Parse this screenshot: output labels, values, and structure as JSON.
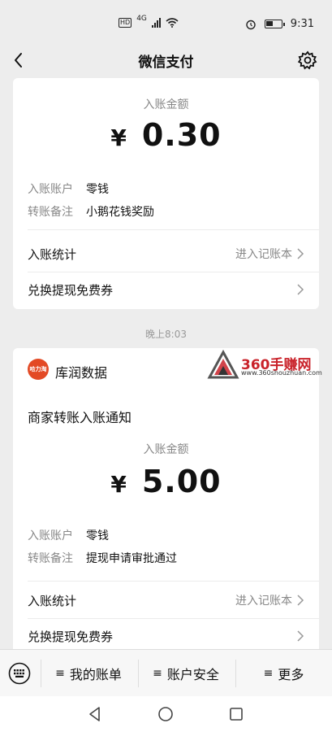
{
  "status_bar": {
    "hd": "HD",
    "network": "4G",
    "time": "9:31",
    "icons": [
      "hd-icon",
      "signal-icon",
      "wifi-icon",
      "alarm-icon",
      "battery-icon"
    ]
  },
  "nav": {
    "title": "微信支付",
    "back_icon": "back-arrow-icon",
    "settings_icon": "gear-icon"
  },
  "card1": {
    "amount_label": "入账金额",
    "currency": "¥",
    "amount": "0.30",
    "account_key": "入账账户",
    "account_val": "零钱",
    "note_key": "转账备注",
    "note_val": "小鹅花钱奖励",
    "stats_label": "入账统计",
    "stats_hint": "进入记账本",
    "coupon_label": "兑换提现免费券"
  },
  "timestamp": "晚上8:03",
  "card2": {
    "merchant_logo_text": "哈力淘",
    "merchant_name": "库润数据",
    "watermark_title": "360手赚网",
    "watermark_url": "www.360shouzhuan.com",
    "notice_title": "商家转账入账通知",
    "amount_label": "入账金额",
    "currency": "¥",
    "amount": "5.00",
    "account_key": "入账账户",
    "account_val": "零钱",
    "note_key": "转账备注",
    "note_val": "提现申请审批通过",
    "stats_label": "入账统计",
    "stats_hint": "进入记账本",
    "coupon_label": "兑换提现免费券"
  },
  "bottom_menu": {
    "keyboard_icon": "keyboard-icon",
    "items": [
      {
        "label": "我的账单"
      },
      {
        "label": "账户安全"
      },
      {
        "label": "更多"
      }
    ],
    "menu_glyph": "≡"
  },
  "colors": {
    "background": "#ededed",
    "card": "#ffffff",
    "text": "#111111",
    "muted": "#888888",
    "watermark_red": "#c9222a",
    "merchant_logo": "#e34a25"
  }
}
